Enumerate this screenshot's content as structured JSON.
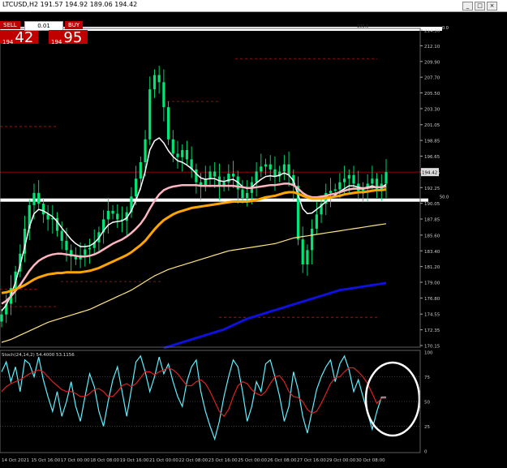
{
  "window": {
    "title": "LTCUSD,H2  191.57 194.92 189.06 194.42",
    "controls": [
      "_",
      "□",
      "×"
    ]
  },
  "trade_panel": {
    "sell_label": "SELL",
    "buy_label": "BUY",
    "lots": "0.01",
    "sell_price_prefix": "194",
    "sell_price_big": "42",
    "buy_price_prefix": "194",
    "buy_price_big": "95"
  },
  "colors": {
    "background": "#000000",
    "candles": "#00e676",
    "ma_fast": "#ffffff",
    "ma_mid": "#ffb6c1",
    "ma_orange": "#ffa500",
    "ma_slow_yellow": "#ffe680",
    "ma_blue": "#1010dd",
    "stoch_main": "#5ff0ff",
    "stoch_signal": "#dd2222",
    "current_price": "#c00000"
  },
  "chart_data": [
    {
      "type": "line",
      "name": "price_panel",
      "y_ticks": [
        "214.30",
        "212.10",
        "209.90",
        "207.70",
        "205.50",
        "203.30",
        "201.05",
        "198.85",
        "196.65",
        "194.45",
        "192.25",
        "190.05",
        "187.85",
        "185.60",
        "183.40",
        "181.20",
        "179.00",
        "176.80",
        "174.55",
        "172.35",
        "170.15"
      ],
      "current_price_label": "194.42",
      "ylim": [
        170.15,
        214.3
      ],
      "horizontal_labels": [
        {
          "text": "100.0",
          "price": 214.3
        },
        {
          "text": "0.0",
          "price": 214.3
        },
        {
          "text": "50.0",
          "price": 190.5
        }
      ],
      "x_tick_labels": [
        "14 Oct 2021",
        "15 Oct 16:00",
        "17 Oct 00:00",
        "18 Oct 08:00",
        "19 Oct 16:00",
        "21 Oct 00:00",
        "22 Oct 08:00",
        "23 Oct 16:00",
        "25 Oct 00:00",
        "26 Oct 08:00",
        "27 Oct 16:00",
        "29 Oct 00:00",
        "30 Oct 08:00"
      ],
      "series": [
        {
          "values": [
            174.5,
            176.0,
            178.2,
            180.5,
            183.0,
            186.5,
            189.8,
            191.5,
            190.0,
            188.5,
            187.8,
            188.0,
            186.2,
            184.8,
            183.5,
            182.6,
            182.2,
            182.8,
            183.6,
            183.8,
            184.6,
            186.0,
            187.8,
            189.0,
            188.6,
            187.8,
            187.6,
            188.8,
            191.0,
            193.5,
            195.8,
            199.0,
            206.0,
            208.0,
            207.0,
            203.5,
            199.0,
            197.0,
            196.5,
            197.5,
            196.2,
            194.8,
            193.0,
            192.5,
            193.5,
            194.5,
            193.8,
            192.5,
            193.0,
            194.2,
            193.8,
            192.0,
            190.8,
            191.5,
            193.0,
            194.5,
            195.2,
            195.5,
            194.8,
            193.8,
            194.5,
            195.5,
            194.0,
            192.5,
            185.0,
            181.5,
            183.5,
            186.5,
            188.5,
            190.0,
            191.5,
            191.8,
            192.0,
            193.0,
            193.5,
            194.0,
            192.8,
            191.8,
            192.2,
            192.8,
            193.5,
            192.0,
            192.8,
            194.42
          ]
        },
        {
          "values": [
            175.0,
            175.8,
            177.2,
            179.0,
            181.4,
            184.0,
            186.8,
            188.6,
            189.2,
            189.0,
            188.6,
            188.2,
            187.5,
            186.6,
            185.8,
            185.0,
            184.4,
            184.0,
            184.0,
            184.1,
            184.5,
            185.2,
            186.2,
            187.0,
            187.4,
            187.5,
            187.6,
            188.0,
            189.0,
            190.5,
            192.2,
            194.5,
            197.5,
            198.8,
            199.2,
            198.5,
            197.4,
            196.6,
            196.0,
            195.8,
            195.4,
            194.9,
            194.2,
            193.6,
            193.4,
            193.5,
            193.5,
            193.2,
            193.1,
            193.3,
            193.4,
            193.0,
            192.4,
            192.1,
            192.3,
            192.9,
            193.4,
            193.8,
            193.9,
            193.8,
            194.0,
            194.3,
            194.0,
            193.2,
            191.2,
            189.3,
            188.6,
            188.7,
            189.2,
            189.7,
            190.3,
            190.8,
            191.2,
            191.7,
            192.1,
            192.5,
            192.5,
            192.3,
            192.2,
            192.3,
            192.5,
            192.3,
            192.3,
            192.7
          ]
        },
        {
          "values": [
            176.0,
            176.4,
            177.0,
            177.8,
            178.6,
            179.6,
            180.6,
            181.4,
            182.0,
            182.4,
            182.7,
            182.9,
            183.0,
            183.0,
            182.9,
            182.8,
            182.7,
            182.6,
            182.6,
            182.7,
            182.9,
            183.2,
            183.6,
            184.0,
            184.4,
            184.7,
            185.0,
            185.4,
            185.9,
            186.5,
            187.2,
            188.1,
            189.3,
            190.4,
            191.3,
            191.9,
            192.2,
            192.4,
            192.5,
            192.6,
            192.6,
            192.6,
            192.6,
            192.5,
            192.5,
            192.5,
            192.5,
            192.5,
            192.5,
            192.5,
            192.5,
            192.4,
            192.3,
            192.2,
            192.2,
            192.3,
            192.4,
            192.5,
            192.6,
            192.6,
            192.7,
            192.8,
            192.8,
            192.6,
            192.1,
            191.5,
            191.1,
            190.9,
            190.9,
            191.0,
            191.1,
            191.3,
            191.4,
            191.6,
            191.8,
            192.0,
            192.1,
            192.1,
            192.1,
            192.2,
            192.3,
            192.3,
            192.3,
            192.4
          ]
        },
        {
          "values": [
            177.5,
            177.6,
            177.8,
            178.0,
            178.3,
            178.6,
            179.0,
            179.4,
            179.7,
            179.9,
            180.1,
            180.2,
            180.3,
            180.3,
            180.4,
            180.4,
            180.4,
            180.4,
            180.5,
            180.6,
            180.8,
            181.0,
            181.3,
            181.6,
            181.9,
            182.2,
            182.5,
            182.8,
            183.2,
            183.7,
            184.2,
            184.8,
            185.6,
            186.4,
            187.1,
            187.7,
            188.1,
            188.5,
            188.8,
            189.0,
            189.2,
            189.4,
            189.5,
            189.6,
            189.7,
            189.8,
            189.9,
            190.0,
            190.1,
            190.2,
            190.3,
            190.3,
            190.3,
            190.3,
            190.4,
            190.5,
            190.7,
            190.9,
            191.0,
            191.1,
            191.3,
            191.5,
            191.6,
            191.6,
            191.4,
            191.1,
            190.9,
            190.7,
            190.7,
            190.7,
            190.8,
            190.9,
            191.0,
            191.1,
            191.3,
            191.4,
            191.5,
            191.6,
            191.6,
            191.7,
            191.8,
            191.9,
            191.9,
            192.0
          ]
        },
        {
          "values": [
            170.6,
            170.8,
            171.0,
            171.3,
            171.6,
            171.9,
            172.2,
            172.5,
            172.8,
            173.1,
            173.4,
            173.6,
            173.8,
            174.0,
            174.2,
            174.4,
            174.6,
            174.8,
            175.0,
            175.2,
            175.5,
            175.8,
            176.1,
            176.4,
            176.7,
            177.0,
            177.3,
            177.6,
            177.9,
            178.3,
            178.7,
            179.1,
            179.5,
            179.9,
            180.2,
            180.5,
            180.8,
            181.0,
            181.2,
            181.4,
            181.6,
            181.8,
            182.0,
            182.2,
            182.4,
            182.6,
            182.8,
            183.0,
            183.2,
            183.4,
            183.5,
            183.6,
            183.7,
            183.8,
            183.9,
            184.0,
            184.1,
            184.2,
            184.3,
            184.4,
            184.6,
            184.8,
            185.0,
            185.2,
            185.3,
            185.4,
            185.5,
            185.6,
            185.7,
            185.8,
            185.9,
            186.0,
            186.1,
            186.2,
            186.3,
            186.4,
            186.5,
            186.6,
            186.7,
            186.8,
            186.9,
            187.0,
            187.1,
            187.2
          ]
        },
        {
          "values": [
            null,
            null,
            null,
            null,
            null,
            null,
            null,
            null,
            null,
            null,
            null,
            null,
            null,
            null,
            null,
            null,
            null,
            null,
            null,
            null,
            null,
            null,
            null,
            null,
            null,
            null,
            null,
            null,
            null,
            null,
            null,
            null,
            null,
            null,
            null,
            169.8,
            170.0,
            170.2,
            170.4,
            170.6,
            170.8,
            171.0,
            171.2,
            171.4,
            171.6,
            171.8,
            172.0,
            172.2,
            172.4,
            172.7,
            173.0,
            173.3,
            173.6,
            173.9,
            174.1,
            174.3,
            174.5,
            174.7,
            174.9,
            175.1,
            175.3,
            175.5,
            175.7,
            175.9,
            176.1,
            176.3,
            176.5,
            176.7,
            176.9,
            177.1,
            177.3,
            177.5,
            177.7,
            177.9,
            178.0,
            178.1,
            178.2,
            178.3,
            178.4,
            178.5,
            178.6,
            178.7,
            178.8,
            178.9
          ]
        }
      ]
    },
    {
      "type": "line",
      "name": "stochastic_panel",
      "title": "Stoch(24,14,2) 54.4000 53.1156",
      "y_ticks": [
        "100",
        "75",
        "50",
        "25",
        "0"
      ],
      "ylim": [
        0,
        100
      ],
      "series": [
        {
          "values": [
            80,
            90,
            70,
            85,
            60,
            92,
            88,
            75,
            95,
            72,
            55,
            40,
            60,
            35,
            50,
            70,
            45,
            30,
            55,
            78,
            65,
            40,
            25,
            50,
            72,
            85,
            60,
            35,
            62,
            90,
            96,
            80,
            60,
            75,
            95,
            78,
            88,
            70,
            55,
            45,
            70,
            85,
            92,
            60,
            40,
            25,
            12,
            30,
            55,
            75,
            92,
            85,
            60,
            30,
            45,
            70,
            60,
            88,
            92,
            75,
            55,
            30,
            45,
            80,
            62,
            35,
            18,
            40,
            62,
            75,
            85,
            92,
            70,
            88,
            96,
            82,
            60,
            72,
            55,
            38,
            22,
            40,
            54.4,
            54.4
          ]
        },
        {
          "values": [
            60,
            65,
            68,
            70,
            72,
            75,
            78,
            80,
            82,
            80,
            75,
            70,
            66,
            62,
            60,
            60,
            58,
            55,
            55,
            58,
            62,
            63,
            60,
            55,
            55,
            60,
            66,
            68,
            65,
            68,
            74,
            80,
            80,
            77,
            80,
            82,
            84,
            82,
            78,
            72,
            66,
            66,
            70,
            72,
            68,
            60,
            50,
            40,
            35,
            42,
            55,
            66,
            70,
            68,
            62,
            58,
            56,
            60,
            68,
            75,
            76,
            70,
            60,
            55,
            54,
            50,
            42,
            38,
            40,
            48,
            58,
            68,
            74,
            75,
            80,
            84,
            84,
            80,
            75,
            68,
            58,
            48,
            53.1,
            53.1
          ]
        }
      ]
    }
  ]
}
